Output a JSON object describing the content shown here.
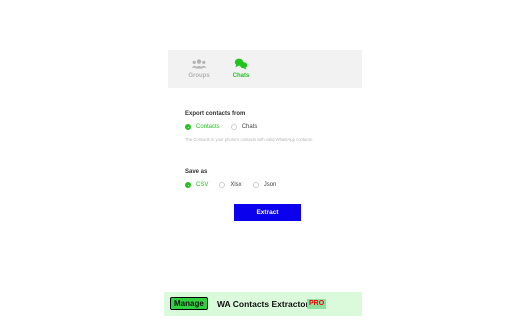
{
  "tabs": [
    {
      "label": "Groups",
      "icon": "groups-icon",
      "active": false
    },
    {
      "label": "Chats",
      "icon": "chats-icon",
      "active": true
    }
  ],
  "export": {
    "title": "Export contacts from",
    "options": [
      {
        "label": "Contacts",
        "selected": true
      },
      {
        "label": "Chats",
        "selected": false
      }
    ],
    "hint": "The Contacts in your phone's contacts with valid WhatsApp contacts."
  },
  "save_as": {
    "title": "Save as",
    "options": [
      {
        "label": "CSV",
        "selected": true
      },
      {
        "label": "Xlsx",
        "selected": false
      },
      {
        "label": "Json",
        "selected": false
      }
    ]
  },
  "extract_label": "Extract",
  "footer": {
    "manage_label": "Manage",
    "brand": "WA Contacts Extractor",
    "pro_badge": "PRO"
  },
  "colors": {
    "accent_green": "#21c41f",
    "button_blue": "#0a00ee",
    "footer_bg": "#dbfadb",
    "pro_red": "#e00000"
  }
}
